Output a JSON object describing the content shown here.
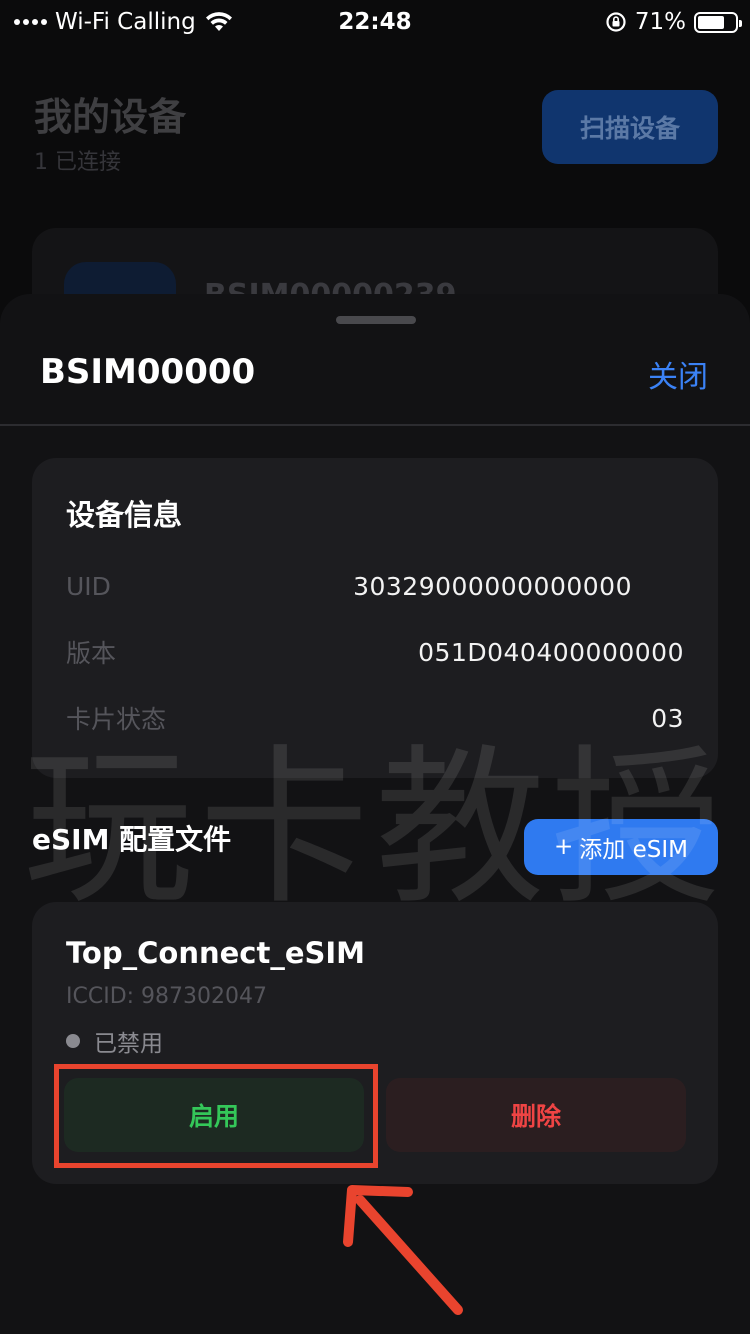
{
  "status_bar": {
    "carrier": "Wi-Fi Calling",
    "time": "22:48",
    "battery_percent": "71%",
    "battery_level": 0.71
  },
  "background": {
    "title": "我的设备",
    "subtitle": "1 已连接",
    "scan_button": "扫描设备",
    "device_name": "BSIM00000239"
  },
  "sheet": {
    "title": "BSIM00000",
    "close_label": "关闭",
    "device_info": {
      "title": "设备信息",
      "rows": [
        {
          "key": "UID",
          "value": "30329000000000000"
        },
        {
          "key": "版本",
          "value": "051D040400000000"
        },
        {
          "key": "卡片状态",
          "value": "03"
        }
      ]
    },
    "esim": {
      "title": "eSIM 配置文件",
      "add_label": "添加 eSIM",
      "profile": {
        "name": "Top_Connect_eSIM",
        "iccid": "ICCID: 987302047",
        "status": "已禁用",
        "enable_label": "启用",
        "delete_label": "删除"
      }
    }
  },
  "watermark": "玩卡教授",
  "colors": {
    "accent": "#3b82f6",
    "add_button": "#2f7af0",
    "enable": "#34c759",
    "delete": "#ef4444",
    "annotation": "#e9442e"
  }
}
